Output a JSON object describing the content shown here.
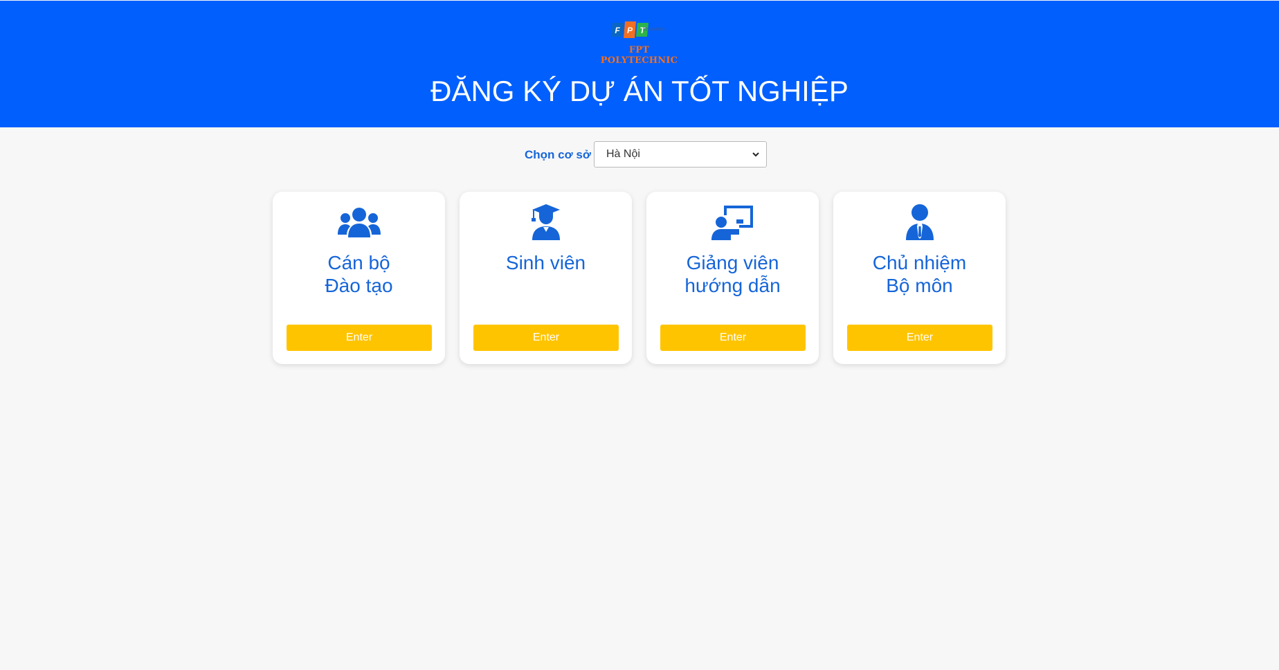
{
  "header": {
    "logo_text": "FPT POLYTECHNIC",
    "logo_letters": [
      "F",
      "P",
      "T"
    ],
    "logo_sub": "Education",
    "title": "ĐĂNG KÝ DỰ ÁN TỐT NGHIỆP",
    "background_color": "#005ffd"
  },
  "campus": {
    "label": "Chọn cơ sở",
    "selected": "Hà Nội"
  },
  "cards": [
    {
      "icon": "users-group-icon",
      "line1": "Cán bộ",
      "line2": "Đào tạo",
      "button": "Enter"
    },
    {
      "icon": "graduate-student-icon",
      "line1": "Sinh viên",
      "line2": "",
      "button": "Enter"
    },
    {
      "icon": "teacher-board-icon",
      "line1": "Giảng viên",
      "line2": "hướng dẫn",
      "button": "Enter"
    },
    {
      "icon": "user-tie-icon",
      "line1": "Chủ nhiệm",
      "line2": "Bộ môn",
      "button": "Enter"
    }
  ],
  "colors": {
    "accent": "#1565d8",
    "button": "#ffc400",
    "page_bg": "#f7f7f7"
  }
}
